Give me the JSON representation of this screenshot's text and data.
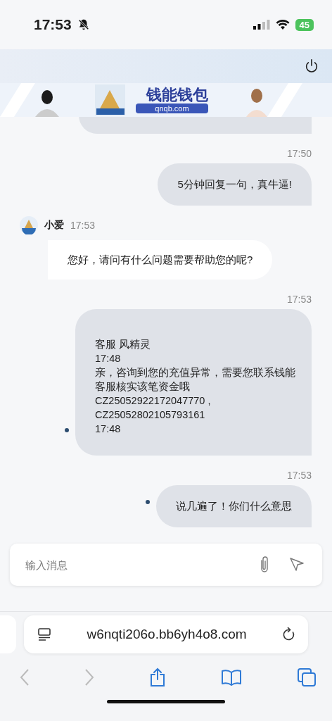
{
  "status_bar": {
    "time": "17:53",
    "battery": "45"
  },
  "banner": {
    "title": "钱能钱包",
    "url": "qnqb.com"
  },
  "messages": [
    {
      "kind": "partial"
    },
    {
      "kind": "sent",
      "time": "17:50",
      "text": "5分钟回复一句，真牛逼!",
      "status_dot": false
    },
    {
      "kind": "received",
      "sender": "小爱",
      "time": "17:53",
      "text": "您好，请问有什么问题需要帮助您的呢?"
    },
    {
      "kind": "sent",
      "time": "17:53",
      "text": "客服 风精灵\n17:48\n亲，咨询到您的充值异常，需要您联系钱能客服核实该笔资金哦\nCZ25052922172047770 ,\nCZ25052802105793161\n17:48",
      "status_dot": true
    },
    {
      "kind": "sent",
      "time": "17:53",
      "text": "说几遍了！你们什么意思",
      "status_dot": true
    }
  ],
  "composer": {
    "placeholder": "输入消息"
  },
  "browser": {
    "url": "w6nqti206o.bb6yh4o8.com"
  }
}
